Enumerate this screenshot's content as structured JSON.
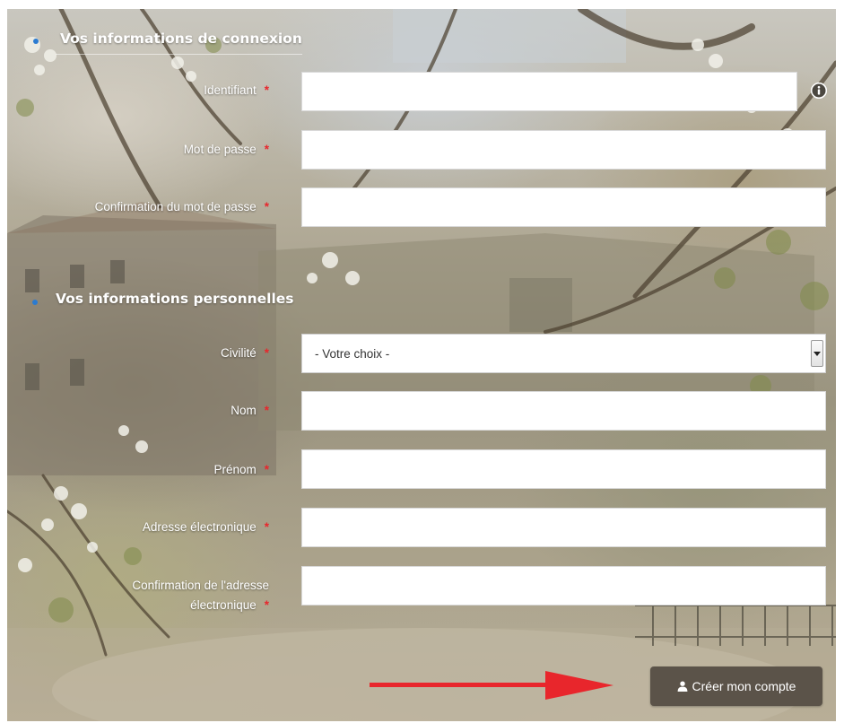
{
  "sections": {
    "login_title": "Vos informations de connexion",
    "personal_title": "Vos informations personnelles"
  },
  "fields": {
    "identifiant": {
      "label": "Identifiant",
      "value": ""
    },
    "password": {
      "label": "Mot de passe",
      "value": ""
    },
    "password_confirm": {
      "label": "Confirmation du mot de passe",
      "value": ""
    },
    "civilite": {
      "label": "Civilité",
      "selected": "- Votre choix -"
    },
    "nom": {
      "label": "Nom",
      "value": ""
    },
    "prenom": {
      "label": "Prénom",
      "value": ""
    },
    "email": {
      "label": "Adresse électronique",
      "value": ""
    },
    "email_confirm": {
      "label_line1": "Confirmation de l'adresse",
      "label_line2": "électronique",
      "value": ""
    }
  },
  "required_marker": "*",
  "submit": {
    "label": "Créer mon compte",
    "icon": "user-icon"
  },
  "icons": {
    "info": "info-icon",
    "dropdown": "chevron-down-icon"
  },
  "colors": {
    "required": "#e8262c",
    "bullet": "#2b7bd1",
    "button_bg": "#5b5349",
    "annotation_arrow": "#e8262c"
  }
}
